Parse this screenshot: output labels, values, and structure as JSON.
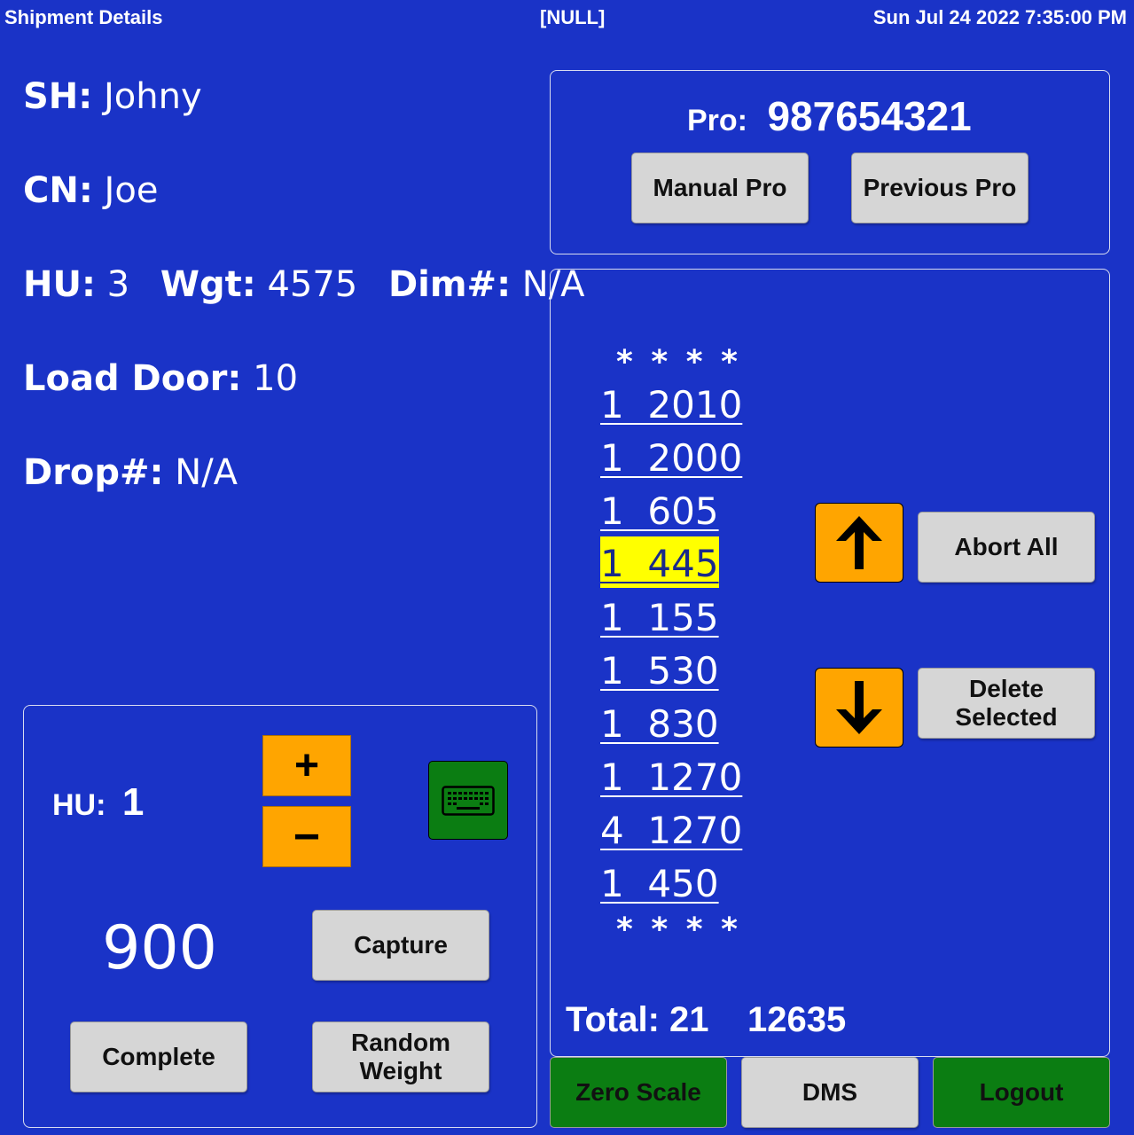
{
  "topbar": {
    "title": "Shipment Details",
    "center": "[NULL]",
    "datetime": "Sun Jul 24 2022 7:35:00 PM"
  },
  "info": {
    "sh_label": "SH:",
    "sh_value": "Johny",
    "cn_label": "CN:",
    "cn_value": "Joe",
    "hu_label": "HU:",
    "hu_value": "3",
    "wgt_label": "Wgt:",
    "wgt_value": "4575",
    "dim_label": "Dim#:",
    "dim_value": "N/A",
    "door_label": "Load Door:",
    "door_value": "10",
    "drop_label": "Drop#:",
    "drop_value": "N/A"
  },
  "pro": {
    "label": "Pro:",
    "value": "987654321",
    "manual_label": "Manual Pro",
    "previous_label": "Previous Pro"
  },
  "capture": {
    "hu_label": "HU:",
    "hu_value": "1",
    "plus_glyph": "+",
    "minus_glyph": "−",
    "keyboard_icon": "keyboard-icon",
    "weight": "900",
    "capture_label": "Capture",
    "complete_label": "Complete",
    "random_weight_label": "Random Weight"
  },
  "list": {
    "marker": "* * * *",
    "rows": [
      {
        "text": "1  2010",
        "selected": false
      },
      {
        "text": "1  2000",
        "selected": false
      },
      {
        "text": "1  605",
        "selected": false
      },
      {
        "text": "1  445",
        "selected": true
      },
      {
        "text": "1  155",
        "selected": false
      },
      {
        "text": "1  530",
        "selected": false
      },
      {
        "text": "1  830",
        "selected": false
      },
      {
        "text": "1  1270",
        "selected": false
      },
      {
        "text": "4  1270",
        "selected": false
      },
      {
        "text": "1  450",
        "selected": false
      }
    ],
    "total_label": "Total: 21",
    "total_weight": "12635",
    "abort_label": "Abort All",
    "delete_label": "Delete Selected",
    "up_icon": "arrow-up-icon",
    "down_icon": "arrow-down-icon"
  },
  "footer": {
    "zero_scale_label": "Zero Scale",
    "dms_label": "DMS",
    "logout_label": "Logout"
  },
  "colors": {
    "background": "#1a33c7",
    "accent_orange": "#ffa500",
    "accent_green": "#0b7d12",
    "selected_row": "#ffff00",
    "button_gray": "#d6d6d6"
  }
}
